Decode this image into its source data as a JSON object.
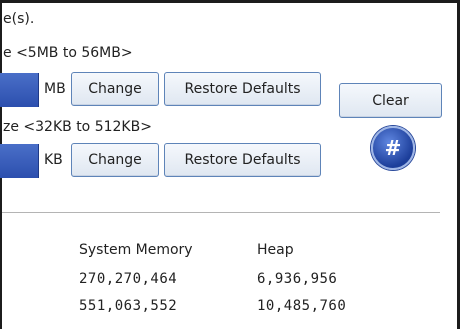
{
  "top_text": "e(s).",
  "range1": "e <5MB to 56MB>",
  "unit1": "MB",
  "change_label": "Change",
  "restore_label": "Restore Defaults",
  "clear_label": "Clear",
  "range2": "ze <32KB to 512KB>",
  "unit2": "KB",
  "hash_label": "#",
  "table": {
    "headers": [
      "System Memory",
      "Heap"
    ],
    "rows": [
      [
        "270,270,464",
        "6,936,956"
      ],
      [
        "551,063,552",
        "10,485,760"
      ]
    ]
  },
  "colors": {
    "blue_field": "#2c4fae",
    "button_border": "#5e84b8",
    "frame": "#1c1c1c"
  }
}
